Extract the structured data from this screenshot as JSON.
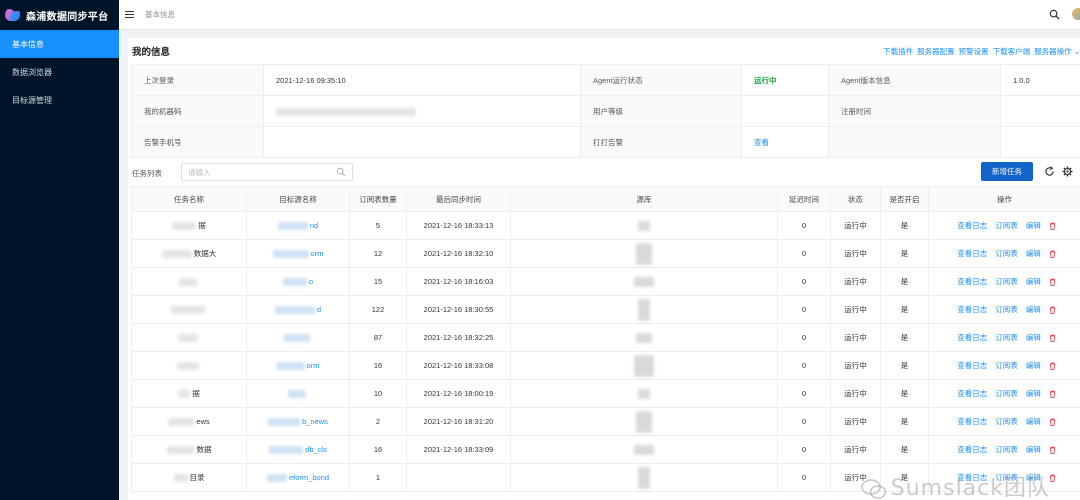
{
  "app": {
    "title": "森浦数据同步平台"
  },
  "sidebar": {
    "items": [
      {
        "label": "基本信息",
        "active": true
      },
      {
        "label": "数据浏览器",
        "active": false
      },
      {
        "label": "目标源管理",
        "active": false
      }
    ]
  },
  "header": {
    "breadcrumb": "基本信息"
  },
  "info": {
    "title": "我的信息",
    "links": [
      "下载插件",
      "服务器配置",
      "预警设置",
      "下载客户端",
      "服务器操作 ⌄"
    ],
    "rows": [
      {
        "l1": "上次登录",
        "v1": "2021-12-16 09:35:10",
        "l2": "Agent运行状态",
        "v2": "运行中",
        "l3": "Agent版本信息",
        "v3": "1.0.0"
      },
      {
        "l1": "我的机器码",
        "v1": "",
        "l2": "用户等级",
        "v2": "",
        "l3": "注册时间",
        "v3": ""
      },
      {
        "l1": "告警手机号",
        "v1": "",
        "l2": "打打告警",
        "v2": "查看",
        "l3": "",
        "v3": ""
      }
    ]
  },
  "tasks": {
    "label": "任务列表",
    "search_placeholder": "请输入",
    "add_label": "新增任务",
    "columns": [
      "任务名称",
      "目标源名称",
      "订阅表数量",
      "最后同步时间",
      "源库",
      "延迟时间",
      "状态",
      "是否开启",
      "操作"
    ],
    "actions": [
      "查看日志",
      "订阅表",
      "编辑"
    ],
    "rows": [
      {
        "name": "据",
        "target": "nd",
        "count": "5",
        "time": "2021-12-16 18:33:13",
        "delay": "0",
        "status": "运行中",
        "enabled": "是"
      },
      {
        "name": "数据大",
        "target": "orm",
        "count": "12",
        "time": "2021-12-16 18:32:10",
        "delay": "0",
        "status": "运行中",
        "enabled": "是"
      },
      {
        "name": "",
        "target": "o",
        "count": "15",
        "time": "2021-12-16 18:16:03",
        "delay": "0",
        "status": "运行中",
        "enabled": "是"
      },
      {
        "name": "",
        "target": "d",
        "count": "122",
        "time": "2021-12-16 18:30:55",
        "delay": "0",
        "status": "运行中",
        "enabled": "是"
      },
      {
        "name": "",
        "target": "",
        "count": "87",
        "time": "2021-12-16 18:32:25",
        "delay": "0",
        "status": "运行中",
        "enabled": "是"
      },
      {
        "name": "",
        "target": "orm",
        "count": "16",
        "time": "2021-12-16 18:33:08",
        "delay": "0",
        "status": "运行中",
        "enabled": "是"
      },
      {
        "name": "据",
        "target": "",
        "count": "10",
        "time": "2021-12-16 18:00:19",
        "delay": "0",
        "status": "运行中",
        "enabled": "是"
      },
      {
        "name": "ews",
        "target": "b_news",
        "count": "2",
        "time": "2021-12-16 18:31:20",
        "delay": "0",
        "status": "运行中",
        "enabled": "是"
      },
      {
        "name": "数据",
        "target": "db_cls",
        "count": "16",
        "time": "2021-12-16 18:33:09",
        "delay": "0",
        "status": "运行中",
        "enabled": "是"
      },
      {
        "name": "目录",
        "target": "eform_bond",
        "count": "1",
        "time": "",
        "delay": "0",
        "status": "运行中",
        "enabled": "是"
      }
    ]
  },
  "watermark": "Sumslack团队"
}
